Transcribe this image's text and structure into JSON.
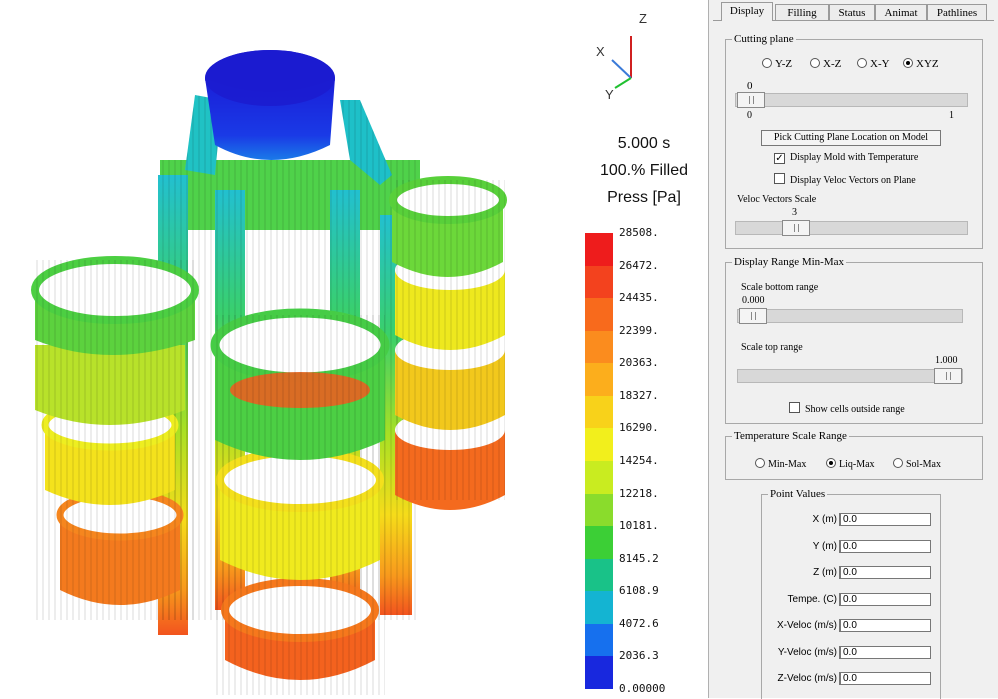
{
  "viewport": {
    "axis_labels": {
      "z": "Z",
      "x": "X",
      "y": "Y"
    },
    "time": "5.000 s",
    "fill": "100.% Filled",
    "quantity": "Press [Pa]",
    "scale_ticks": [
      "28508.",
      "26472.",
      "24435.",
      "22399.",
      "20363.",
      "18327.",
      "16290.",
      "14254.",
      "12218.",
      "10181.",
      "8145.2",
      "6108.9",
      "4072.6",
      "2036.3",
      "0.00000"
    ],
    "scale_colors": [
      "#ee1c1c",
      "#f3421e",
      "#f86a1c",
      "#fb8c1e",
      "#fcae1c",
      "#f8d21a",
      "#f2ef1c",
      "#c9ec20",
      "#8adc2c",
      "#3ccf36",
      "#19c288",
      "#14b4d2",
      "#1670ee",
      "#1828de"
    ]
  },
  "panel": {
    "tabs": [
      "Display",
      "Filling",
      "Status",
      "Animat",
      "Pathlines"
    ],
    "active_tab": 0,
    "cutting_plane": {
      "legend": "Cutting plane",
      "options": [
        "Y-Z",
        "X-Z",
        "X-Y",
        "XYZ"
      ],
      "selected": 3,
      "slider_value": "0",
      "slider_min": "0",
      "slider_max": "1",
      "pick_button": "Pick Cutting Plane Location on Model",
      "display_mold_label": "Display Mold with Temperature",
      "display_mold_checked": true,
      "display_veloc_label": "Display Veloc Vectors on Plane",
      "display_veloc_checked": false,
      "veloc_scale_label": "Veloc Vectors Scale",
      "veloc_scale_value": "3"
    },
    "display_range": {
      "legend": "Display Range Min-Max",
      "bottom_label": "Scale bottom range",
      "bottom_value": "0.000",
      "top_label": "Scale top range",
      "top_value": "1.000",
      "show_outside_label": "Show cells outside range",
      "show_outside_checked": false
    },
    "temp_scale": {
      "legend": "Temperature Scale Range",
      "options": [
        "Min-Max",
        "Liq-Max",
        "Sol-Max"
      ],
      "selected": 1
    },
    "point_values": {
      "legend": "Point Values",
      "fields": [
        {
          "label": "X (m)",
          "value": "0.0"
        },
        {
          "label": "Y (m)",
          "value": "0.0"
        },
        {
          "label": "Z (m)",
          "value": "0.0"
        },
        {
          "label": "Tempe. (C)",
          "value": "0.0"
        },
        {
          "label": "X-Veloc (m/s)",
          "value": "0.0"
        },
        {
          "label": "Y-Veloc (m/s)",
          "value": "0.0"
        },
        {
          "label": "Z-Veloc (m/s)",
          "value": "0.0"
        }
      ]
    }
  }
}
